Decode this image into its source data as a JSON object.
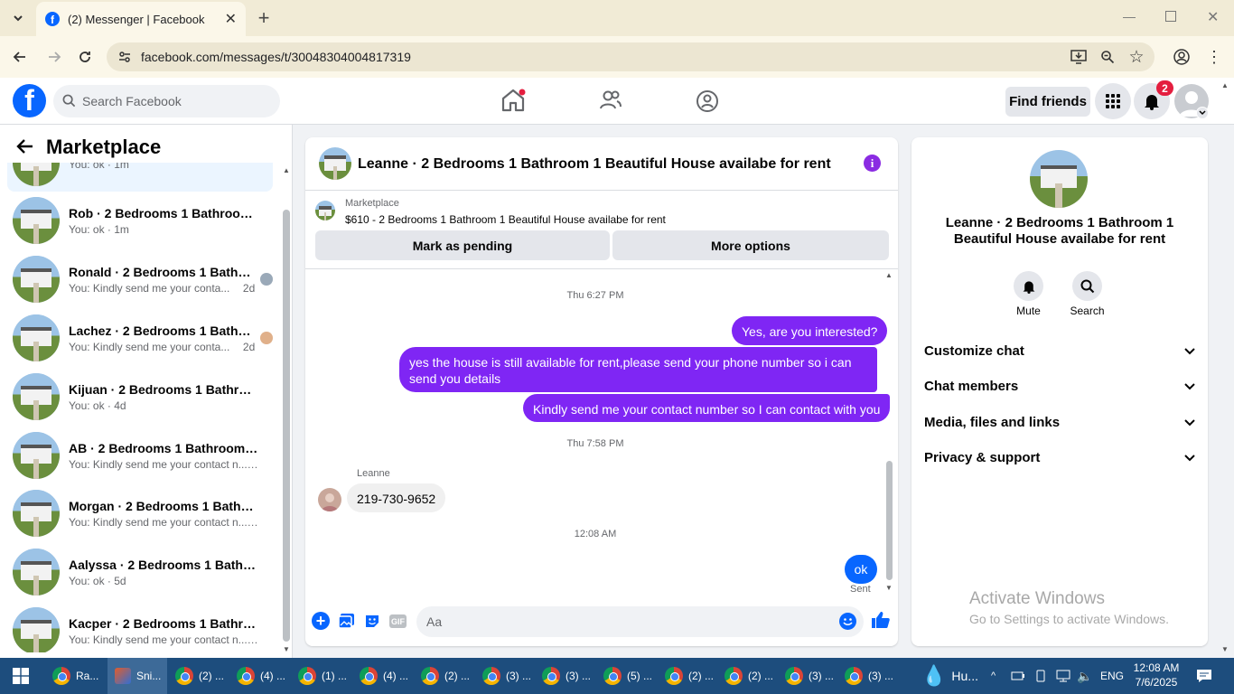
{
  "browser": {
    "tab_title": "(2) Messenger | Facebook",
    "url": "facebook.com/messages/t/30048304004817319"
  },
  "fb": {
    "search_placeholder": "Search Facebook",
    "find_friends": "Find friends",
    "notification_count": "2"
  },
  "left": {
    "title": "Marketplace",
    "conversations": [
      {
        "name": "",
        "preview": "You: ok · 1m"
      },
      {
        "name": "Rob · 2 Bedrooms 1 Bathroom 1 ...",
        "preview": "You: ok · 1m"
      },
      {
        "name": "Ronald · 2 Bedrooms 1 Bathro...",
        "preview": "You: Kindly send me your conta...",
        "time": "2d"
      },
      {
        "name": "Lachez · 2 Bedrooms 1 Bathro...",
        "preview": "You: Kindly send me your conta...",
        "time": "2d"
      },
      {
        "name": "Kijuan · 2 Bedrooms 1 Bathroom...",
        "preview": "You: ok · 4d"
      },
      {
        "name": "AB · 2 Bedrooms 1 Bathroom 1 B...",
        "preview": "You: Kindly send me your contact n... · 4d"
      },
      {
        "name": "Morgan · 2 Bedrooms 1 Bathroo...",
        "preview": "You: Kindly send me your contact n... · 4d"
      },
      {
        "name": "Aalyssa · 2 Bedrooms 1 Bathroo...",
        "preview": "You: ok · 5d"
      },
      {
        "name": "Kacper · 2 Bedrooms 1 Bathroo...",
        "preview": "You: Kindly send me your contact n... · 6d"
      }
    ]
  },
  "chat": {
    "title": "Leanne · 2 Bedrooms 1 Bathroom 1 Beautiful House availabe for rent",
    "listing_label": "Marketplace",
    "listing_title": "$610 - 2 Bedrooms 1 Bathroom 1 Beautiful House availabe for rent",
    "mark_pending": "Mark as pending",
    "more_options": "More options",
    "ts1": "Thu 6:27 PM",
    "msg1": "Yes, are you interested?",
    "msg2": "yes the house is still available for rent,please send your  phone number so i can send you details",
    "msg3": "Kindly send me your contact number so I can contact with you",
    "ts2": "Thu 7:58 PM",
    "sender": "Leanne",
    "msg4": "219-730-9652",
    "ts3": "12:08 AM",
    "msg5": "ok",
    "sent": "Sent",
    "input_placeholder": "Aa"
  },
  "right": {
    "title": "Leanne · 2 Bedrooms 1 Bathroom 1 Beautiful House availabe for rent",
    "mute": "Mute",
    "search": "Search",
    "sections": [
      "Customize chat",
      "Chat members",
      "Media, files and links",
      "Privacy & support"
    ],
    "watermark_title": "Activate Windows",
    "watermark_sub": "Go to Settings to activate Windows."
  },
  "taskbar": {
    "items": [
      "Ra...",
      "Sni...",
      "(2) ...",
      "(4) ...",
      "(1) ...",
      "(4) ...",
      "(2) ...",
      "(3) ...",
      "(3) ...",
      "(5) ...",
      "(2) ...",
      "(2) ...",
      "(3) ...",
      "(3) ..."
    ],
    "weather": "Hu...",
    "lang": "ENG",
    "time": "12:08 AM",
    "date": "7/6/2025"
  },
  "colors": {
    "fb_blue": "#0866ff",
    "purple": "#7f26f4",
    "taskbar": "#1d4d7d"
  }
}
